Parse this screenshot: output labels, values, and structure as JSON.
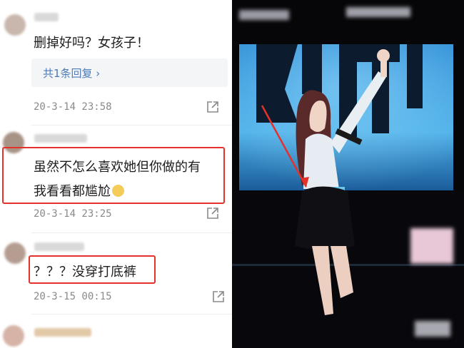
{
  "comments": [
    {
      "text": "删掉好吗？女孩子！",
      "reply_link": "共1条回复 ›",
      "time": "20-3-14 23:58"
    },
    {
      "line1": "虽然不怎么喜欢她但你做的有",
      "line2": "我看看都尴尬",
      "time": "20-3-14 23:25"
    },
    {
      "text": "？？？没穿打底裤",
      "time": "20-3-15 00:15"
    }
  ],
  "icons": {
    "share": "share-icon",
    "emoji": "emoji-icon"
  },
  "colors": {
    "highlight": "#e4312b",
    "reply_link": "#4a7ab7",
    "stage_blue": "#2b8fd4",
    "timestamp": "#8a8a8a"
  }
}
